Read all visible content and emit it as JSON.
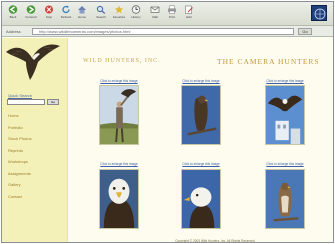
{
  "colors": {
    "sidebar_bg": "#f4f1b8",
    "page_bg": "#fdfcee",
    "heading_gold": "#c8a64a",
    "link_blue": "#3c5fa8",
    "nav_link": "#9a7c2e"
  },
  "browser": {
    "toolbar": [
      {
        "icon": "back-arrow-icon",
        "label": "Back"
      },
      {
        "icon": "forward-arrow-icon",
        "label": "Forward"
      },
      {
        "icon": "stop-icon",
        "label": "Stop"
      },
      {
        "icon": "refresh-icon",
        "label": "Refresh"
      },
      {
        "icon": "home-icon",
        "label": "Home"
      },
      {
        "icon": "search-icon",
        "label": "Search"
      },
      {
        "icon": "favorites-icon",
        "label": "Favorites"
      },
      {
        "icon": "history-icon",
        "label": "History"
      },
      {
        "icon": "mail-icon",
        "label": "Mail"
      },
      {
        "icon": "print-icon",
        "label": "Print"
      },
      {
        "icon": "edit-icon",
        "label": "Edit"
      }
    ],
    "address_label": "Address",
    "address_value": "http://www.wildlifecameras.com/images/photos.html",
    "go_label": "Go"
  },
  "sidebar": {
    "search_label": "Quick Search",
    "search_button": "Go",
    "nav_items": [
      "Home",
      "Portfolio",
      "Stock Photos",
      "Reprints",
      "Workshops",
      "Assignments",
      "Gallery",
      "Contact"
    ]
  },
  "content": {
    "site_name": "WILD HUNTERS, INC.",
    "page_heading": "THE CAMERA HUNTERS",
    "thumbnails": [
      {
        "label": "Click to enlarge this image",
        "subject": "falconer-with-eagle"
      },
      {
        "label": "Click to enlarge this image",
        "subject": "eagle-on-branch"
      },
      {
        "label": "Click to enlarge this image",
        "subject": "eagle-in-flight"
      },
      {
        "label": "Click to enlarge this image",
        "subject": "bald-eagle-portrait"
      },
      {
        "label": "Click to enlarge this image",
        "subject": "bald-eagle-profile"
      },
      {
        "label": "Click to enlarge this image",
        "subject": "hawk-perched"
      }
    ],
    "footer": "Copyright © 2003 Wild Hunters, Inc. All Rights Reserved"
  }
}
